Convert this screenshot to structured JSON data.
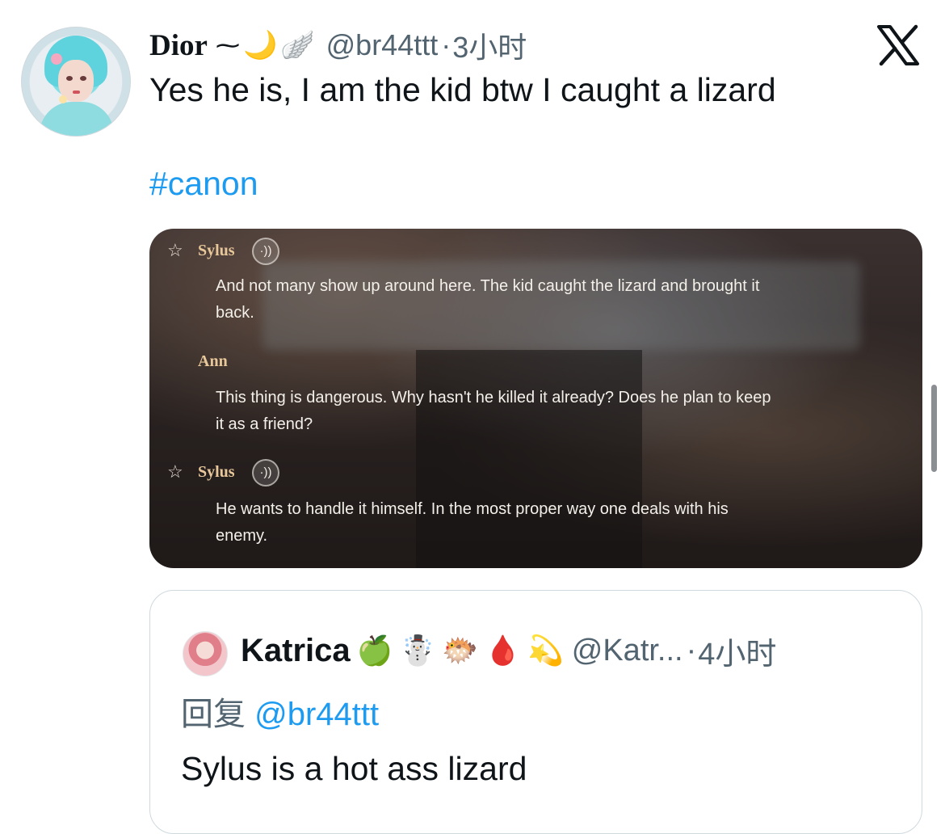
{
  "tweet": {
    "author_name": "Dior",
    "name_decor": "⁓",
    "name_emojis": [
      "🌙",
      "🪽"
    ],
    "handle": "@br44ttt",
    "separator": "·",
    "time": "3小时",
    "text": "Yes he is, I am the kid btw I caught a lizard",
    "hashtag": "#canon"
  },
  "media": {
    "lines": [
      {
        "speaker": "Sylus",
        "star": "☆",
        "audio": "·))",
        "text_1": "And not many show up around here. The kid caught the lizard and brought it",
        "text_2": "back."
      },
      {
        "speaker": "Ann",
        "text_1": "This thing is dangerous. Why hasn't he killed it already? Does he plan to keep",
        "text_2": "it as a friend?"
      },
      {
        "speaker": "Sylus",
        "star": "☆",
        "audio": "·))",
        "text_1": "He wants to handle it himself. In the most proper way one deals with his",
        "text_2": "enemy."
      }
    ]
  },
  "quote": {
    "author_name": "Katrica",
    "name_emojis": [
      "🍏",
      "☃️",
      "🐡",
      "🩸",
      "💫"
    ],
    "handle": "@Katr...",
    "separator": "·",
    "time": "4小时",
    "reply_prefix": "回复",
    "reply_mention": "@br44ttt",
    "text": "Sylus is a hot ass lizard"
  },
  "icons": {
    "x_logo": "x-logo-icon",
    "star": "star-icon",
    "audio": "audio-icon"
  },
  "colors": {
    "link": "#1d9bf0",
    "muted": "#536471",
    "speaker_name": "#e8c89b"
  }
}
